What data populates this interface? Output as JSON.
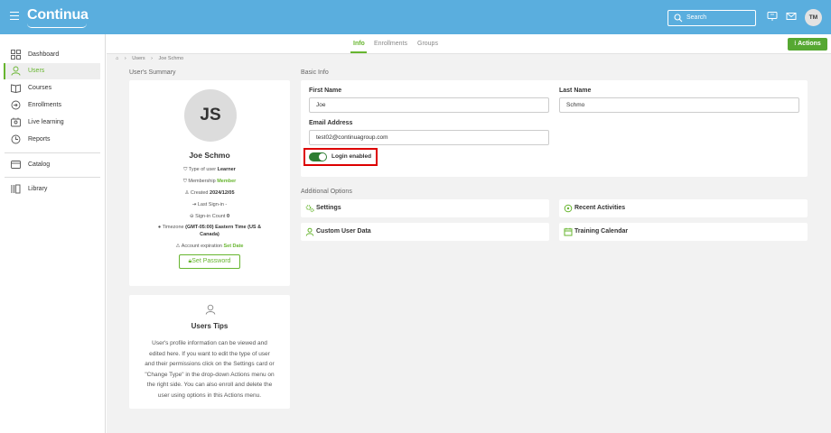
{
  "header": {
    "logo": "Continua",
    "search_placeholder": "Search",
    "user_initials": "TM"
  },
  "sidebar": {
    "items": [
      {
        "label": "Dashboard",
        "icon": "dashboard-icon"
      },
      {
        "label": "Users",
        "icon": "user-icon",
        "active": true
      },
      {
        "label": "Courses",
        "icon": "book-icon"
      },
      {
        "label": "Enrollments",
        "icon": "enroll-icon"
      },
      {
        "label": "Live learning",
        "icon": "live-icon"
      },
      {
        "label": "Reports",
        "icon": "reports-icon"
      },
      {
        "label": "Catalog",
        "icon": "catalog-icon"
      },
      {
        "label": "Library",
        "icon": "library-icon"
      }
    ]
  },
  "tabs": {
    "info": "Info",
    "enrollments": "Enrollments",
    "groups": "Groups",
    "actions": "Actions"
  },
  "breadcrumb": {
    "users": "Users",
    "current": "Joe Schmo"
  },
  "summary": {
    "section_title": "User's Summary",
    "initials": "JS",
    "name": "Joe Schmo",
    "type_label": "Type of user",
    "type_value": "Learner",
    "membership_label": "Membership",
    "membership_value": "Member",
    "created_label": "Created",
    "created_value": "2024/12/05",
    "last_signin": "Last Sign-in -",
    "signin_label": "Sign-in Count",
    "signin_value": "0",
    "timezone_label": "Timezone",
    "timezone_value_1": "(GMT-05:00) Eastern Time (US &",
    "timezone_value_2": "Canada)",
    "expiration_label": "Account expiration",
    "expiration_value": "Set Date",
    "set_password": "Set Password"
  },
  "tips": {
    "title": "Users Tips",
    "lines": [
      "User's profile information can be viewed and",
      "edited here. If you want to edit the type of user",
      "and their permissions click on the Settings card or",
      "\"Change Type\" in the drop-down Actions menu on",
      "the right side. You can also enroll and delete the",
      "user using options in this Actions menu."
    ]
  },
  "basic_info": {
    "section_title": "Basic Info",
    "first_name_label": "First Name",
    "first_name_value": "Joe",
    "last_name_label": "Last Name",
    "last_name_value": "Schmo",
    "email_label": "Email Address",
    "email_value": "test02@continuagroup.com",
    "login_label": "Login enabled",
    "login_enabled": true
  },
  "additional": {
    "section_title": "Additional Options",
    "settings": "Settings",
    "recent_activities": "Recent Activities",
    "custom_user_data": "Custom User Data",
    "training_calendar": "Training Calendar"
  },
  "colors": {
    "header_bg": "#5aaede",
    "accent_green": "#67b52f",
    "actions_bg": "#56a832",
    "toggle_on": "#2e7d32",
    "highlight_red": "#dd0000"
  }
}
